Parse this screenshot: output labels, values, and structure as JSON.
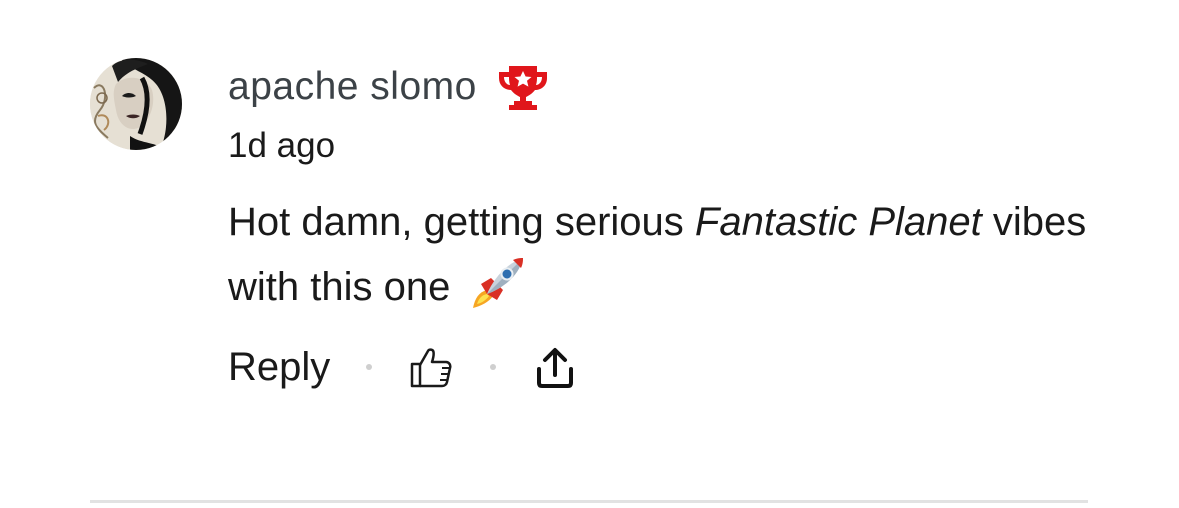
{
  "comment": {
    "author": "apache slomo",
    "badge_icon": "trophy-icon",
    "badge_color": "#e0161b",
    "timestamp": "1d ago",
    "body_prefix": "Hot damn, getting serious ",
    "body_emphasis": "Fantastic Planet",
    "body_suffix": " vibes with this one",
    "body_emoji_icon": "rocket-icon"
  },
  "actions": {
    "reply_label": "Reply",
    "like_icon": "thumbs-up-icon",
    "share_icon": "share-icon"
  }
}
